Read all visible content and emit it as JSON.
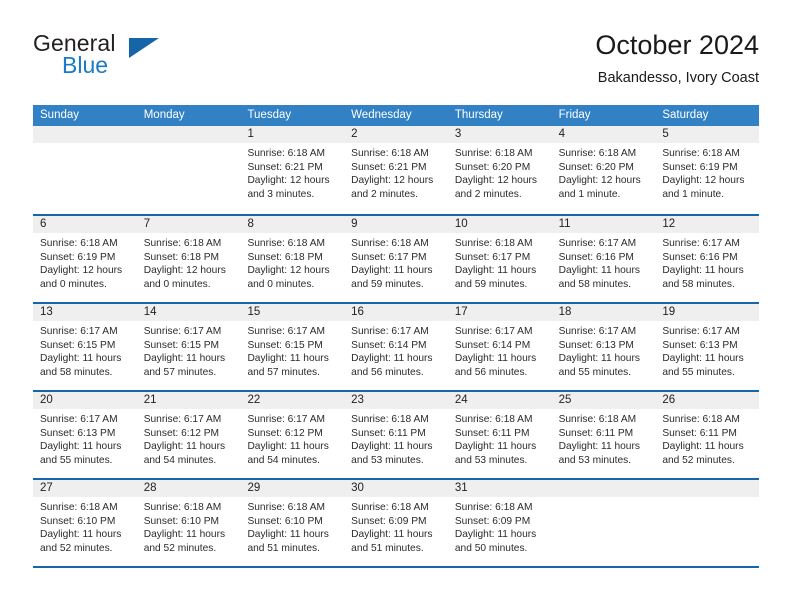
{
  "brand": {
    "word_one": "General",
    "word_two": "Blue",
    "triangle_icon": "triangle-logo-icon"
  },
  "header": {
    "title": "October 2024",
    "subtitle": "Bakandesso, Ivory Coast"
  },
  "colors": {
    "header_blue": "#3281c4",
    "rule_blue": "#1565a8",
    "daynum_gray": "#efefef",
    "brand_blue": "#1a7bc4"
  },
  "weekdays": [
    "Sunday",
    "Monday",
    "Tuesday",
    "Wednesday",
    "Thursday",
    "Friday",
    "Saturday"
  ],
  "labels": {
    "sunrise_prefix": "Sunrise: ",
    "sunset_prefix": "Sunset: ",
    "daylight_prefix": "Daylight: "
  },
  "weeks": [
    [
      {
        "day": "",
        "sunrise": "",
        "sunset": "",
        "daylight": ""
      },
      {
        "day": "",
        "sunrise": "",
        "sunset": "",
        "daylight": ""
      },
      {
        "day": "1",
        "sunrise": "Sunrise: 6:18 AM",
        "sunset": "Sunset: 6:21 PM",
        "daylight": "Daylight: 12 hours and 3 minutes."
      },
      {
        "day": "2",
        "sunrise": "Sunrise: 6:18 AM",
        "sunset": "Sunset: 6:21 PM",
        "daylight": "Daylight: 12 hours and 2 minutes."
      },
      {
        "day": "3",
        "sunrise": "Sunrise: 6:18 AM",
        "sunset": "Sunset: 6:20 PM",
        "daylight": "Daylight: 12 hours and 2 minutes."
      },
      {
        "day": "4",
        "sunrise": "Sunrise: 6:18 AM",
        "sunset": "Sunset: 6:20 PM",
        "daylight": "Daylight: 12 hours and 1 minute."
      },
      {
        "day": "5",
        "sunrise": "Sunrise: 6:18 AM",
        "sunset": "Sunset: 6:19 PM",
        "daylight": "Daylight: 12 hours and 1 minute."
      }
    ],
    [
      {
        "day": "6",
        "sunrise": "Sunrise: 6:18 AM",
        "sunset": "Sunset: 6:19 PM",
        "daylight": "Daylight: 12 hours and 0 minutes."
      },
      {
        "day": "7",
        "sunrise": "Sunrise: 6:18 AM",
        "sunset": "Sunset: 6:18 PM",
        "daylight": "Daylight: 12 hours and 0 minutes."
      },
      {
        "day": "8",
        "sunrise": "Sunrise: 6:18 AM",
        "sunset": "Sunset: 6:18 PM",
        "daylight": "Daylight: 12 hours and 0 minutes."
      },
      {
        "day": "9",
        "sunrise": "Sunrise: 6:18 AM",
        "sunset": "Sunset: 6:17 PM",
        "daylight": "Daylight: 11 hours and 59 minutes."
      },
      {
        "day": "10",
        "sunrise": "Sunrise: 6:18 AM",
        "sunset": "Sunset: 6:17 PM",
        "daylight": "Daylight: 11 hours and 59 minutes."
      },
      {
        "day": "11",
        "sunrise": "Sunrise: 6:17 AM",
        "sunset": "Sunset: 6:16 PM",
        "daylight": "Daylight: 11 hours and 58 minutes."
      },
      {
        "day": "12",
        "sunrise": "Sunrise: 6:17 AM",
        "sunset": "Sunset: 6:16 PM",
        "daylight": "Daylight: 11 hours and 58 minutes."
      }
    ],
    [
      {
        "day": "13",
        "sunrise": "Sunrise: 6:17 AM",
        "sunset": "Sunset: 6:15 PM",
        "daylight": "Daylight: 11 hours and 58 minutes."
      },
      {
        "day": "14",
        "sunrise": "Sunrise: 6:17 AM",
        "sunset": "Sunset: 6:15 PM",
        "daylight": "Daylight: 11 hours and 57 minutes."
      },
      {
        "day": "15",
        "sunrise": "Sunrise: 6:17 AM",
        "sunset": "Sunset: 6:15 PM",
        "daylight": "Daylight: 11 hours and 57 minutes."
      },
      {
        "day": "16",
        "sunrise": "Sunrise: 6:17 AM",
        "sunset": "Sunset: 6:14 PM",
        "daylight": "Daylight: 11 hours and 56 minutes."
      },
      {
        "day": "17",
        "sunrise": "Sunrise: 6:17 AM",
        "sunset": "Sunset: 6:14 PM",
        "daylight": "Daylight: 11 hours and 56 minutes."
      },
      {
        "day": "18",
        "sunrise": "Sunrise: 6:17 AM",
        "sunset": "Sunset: 6:13 PM",
        "daylight": "Daylight: 11 hours and 55 minutes."
      },
      {
        "day": "19",
        "sunrise": "Sunrise: 6:17 AM",
        "sunset": "Sunset: 6:13 PM",
        "daylight": "Daylight: 11 hours and 55 minutes."
      }
    ],
    [
      {
        "day": "20",
        "sunrise": "Sunrise: 6:17 AM",
        "sunset": "Sunset: 6:13 PM",
        "daylight": "Daylight: 11 hours and 55 minutes."
      },
      {
        "day": "21",
        "sunrise": "Sunrise: 6:17 AM",
        "sunset": "Sunset: 6:12 PM",
        "daylight": "Daylight: 11 hours and 54 minutes."
      },
      {
        "day": "22",
        "sunrise": "Sunrise: 6:17 AM",
        "sunset": "Sunset: 6:12 PM",
        "daylight": "Daylight: 11 hours and 54 minutes."
      },
      {
        "day": "23",
        "sunrise": "Sunrise: 6:18 AM",
        "sunset": "Sunset: 6:11 PM",
        "daylight": "Daylight: 11 hours and 53 minutes."
      },
      {
        "day": "24",
        "sunrise": "Sunrise: 6:18 AM",
        "sunset": "Sunset: 6:11 PM",
        "daylight": "Daylight: 11 hours and 53 minutes."
      },
      {
        "day": "25",
        "sunrise": "Sunrise: 6:18 AM",
        "sunset": "Sunset: 6:11 PM",
        "daylight": "Daylight: 11 hours and 53 minutes."
      },
      {
        "day": "26",
        "sunrise": "Sunrise: 6:18 AM",
        "sunset": "Sunset: 6:11 PM",
        "daylight": "Daylight: 11 hours and 52 minutes."
      }
    ],
    [
      {
        "day": "27",
        "sunrise": "Sunrise: 6:18 AM",
        "sunset": "Sunset: 6:10 PM",
        "daylight": "Daylight: 11 hours and 52 minutes."
      },
      {
        "day": "28",
        "sunrise": "Sunrise: 6:18 AM",
        "sunset": "Sunset: 6:10 PM",
        "daylight": "Daylight: 11 hours and 52 minutes."
      },
      {
        "day": "29",
        "sunrise": "Sunrise: 6:18 AM",
        "sunset": "Sunset: 6:10 PM",
        "daylight": "Daylight: 11 hours and 51 minutes."
      },
      {
        "day": "30",
        "sunrise": "Sunrise: 6:18 AM",
        "sunset": "Sunset: 6:09 PM",
        "daylight": "Daylight: 11 hours and 51 minutes."
      },
      {
        "day": "31",
        "sunrise": "Sunrise: 6:18 AM",
        "sunset": "Sunset: 6:09 PM",
        "daylight": "Daylight: 11 hours and 50 minutes."
      },
      {
        "day": "",
        "sunrise": "",
        "sunset": "",
        "daylight": ""
      },
      {
        "day": "",
        "sunrise": "",
        "sunset": "",
        "daylight": ""
      }
    ]
  ]
}
